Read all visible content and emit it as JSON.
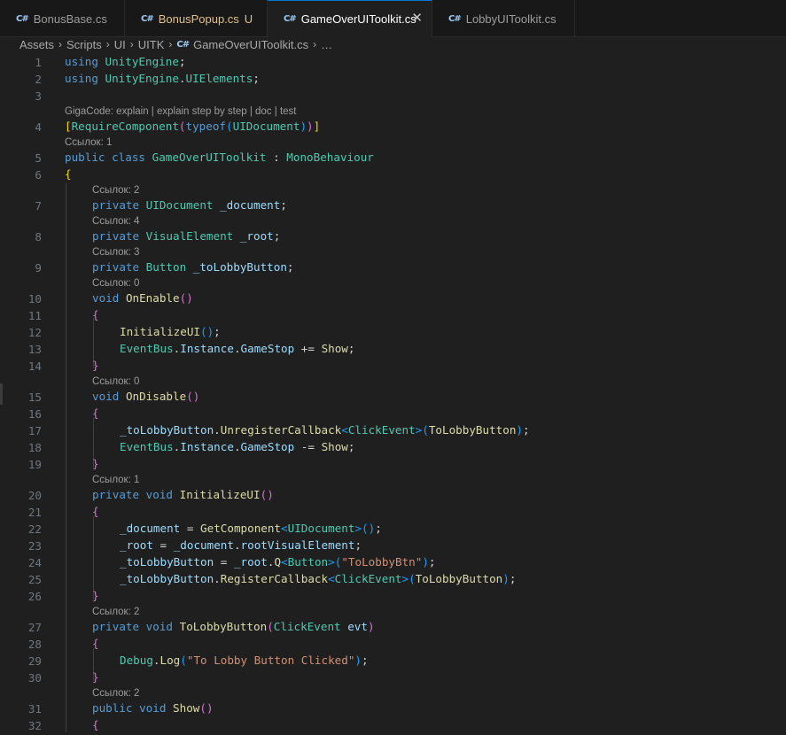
{
  "tabs": [
    {
      "label": "BonusBase.cs",
      "active": false,
      "badge": "",
      "icon": "csharp-icon"
    },
    {
      "label": "BonusPopup.cs",
      "active": false,
      "badge": "U",
      "icon": "csharp-icon"
    },
    {
      "label": "GameOverUIToolkit.cs",
      "active": true,
      "badge": "",
      "icon": "csharp-icon",
      "close": "✕"
    },
    {
      "label": "LobbyUIToolkit.cs",
      "active": false,
      "badge": "",
      "icon": "csharp-icon"
    }
  ],
  "breadcrumb": [
    "Assets",
    "Scripts",
    "UI",
    "UITK",
    "GameOverUIToolkit.cs",
    "…"
  ],
  "code_lens": {
    "gigacode": "GigaCode: explain | explain step by step | doc | test",
    "ref1": "Ссылок: 1",
    "ref2": "Ссылок: 2",
    "ref3": "Ссылок: 3",
    "ref4": "Ссылок: 4",
    "ref0": "Ссылок: 0"
  },
  "line_numbers": [
    "1",
    "2",
    "3",
    "4",
    "5",
    "6",
    "7",
    "8",
    "9",
    "10",
    "11",
    "12",
    "13",
    "14",
    "15",
    "16",
    "17",
    "18",
    "19",
    "20",
    "21",
    "22",
    "23",
    "24",
    "25",
    "26",
    "27",
    "28",
    "29",
    "30",
    "31",
    "32"
  ],
  "code": {
    "l1_a": "using",
    "l1_b": "UnityEngine",
    "l1_c": ";",
    "l2_a": "using",
    "l2_b": "UnityEngine",
    "l2_c": ".",
    "l2_d": "UIElements",
    "l2_e": ";",
    "l4_a": "[",
    "l4_b": "RequireComponent",
    "l4_c": "(",
    "l4_d": "typeof",
    "l4_e": "(",
    "l4_f": "UIDocument",
    "l4_g": ")",
    "l4_h": ")",
    "l4_i": "]",
    "l5_a": "public",
    "l5_b": "class",
    "l5_c": "GameOverUIToolkit",
    "l5_d": ":",
    "l5_e": "MonoBehaviour",
    "l6_a": "{",
    "l7_a": "private",
    "l7_b": "UIDocument",
    "l7_c": "_document",
    "l7_d": ";",
    "l8_a": "private",
    "l8_b": "VisualElement",
    "l8_c": "_root",
    "l8_d": ";",
    "l9_a": "private",
    "l9_b": "Button",
    "l9_c": "_toLobbyButton",
    "l9_d": ";",
    "l10_a": "void",
    "l10_b": "OnEnable",
    "l10_c": "()",
    "l11_a": "{",
    "l12_a": "InitializeUI",
    "l12_b": "()",
    "l12_c": ";",
    "l13_a": "EventBus",
    "l13_b": ".",
    "l13_c": "Instance",
    "l13_d": ".",
    "l13_e": "GameStop",
    "l13_f": "+=",
    "l13_g": "Show",
    "l13_h": ";",
    "l14_a": "}",
    "l15_a": "void",
    "l15_b": "OnDisable",
    "l15_c": "()",
    "l16_a": "{",
    "l17_a": "_toLobbyButton",
    "l17_b": ".",
    "l17_c": "UnregisterCallback",
    "l17_d": "<",
    "l17_e": "ClickEvent",
    "l17_f": ">",
    "l17_g": "(",
    "l17_h": "ToLobbyButton",
    "l17_i": ")",
    "l17_j": ";",
    "l18_a": "EventBus",
    "l18_b": ".",
    "l18_c": "Instance",
    "l18_d": ".",
    "l18_e": "GameStop",
    "l18_f": "-=",
    "l18_g": "Show",
    "l18_h": ";",
    "l19_a": "}",
    "l20_a": "private",
    "l20_b": "void",
    "l20_c": "InitializeUI",
    "l20_d": "()",
    "l21_a": "{",
    "l22_a": "_document",
    "l22_b": "=",
    "l22_c": "GetComponent",
    "l22_d": "<",
    "l22_e": "UIDocument",
    "l22_f": ">",
    "l22_g": "()",
    "l22_h": ";",
    "l23_a": "_root",
    "l23_b": "=",
    "l23_c": "_document",
    "l23_d": ".",
    "l23_e": "rootVisualElement",
    "l23_f": ";",
    "l24_a": "_toLobbyButton",
    "l24_b": "=",
    "l24_c": "_root",
    "l24_d": ".",
    "l24_e": "Q",
    "l24_f": "<",
    "l24_g": "Button",
    "l24_h": ">",
    "l24_i": "(",
    "l24_j": "\"ToLobbyBtn\"",
    "l24_k": ")",
    "l24_l": ";",
    "l25_a": "_toLobbyButton",
    "l25_b": ".",
    "l25_c": "RegisterCallback",
    "l25_d": "<",
    "l25_e": "ClickEvent",
    "l25_f": ">",
    "l25_g": "(",
    "l25_h": "ToLobbyButton",
    "l25_i": ")",
    "l25_j": ";",
    "l26_a": "}",
    "l27_a": "private",
    "l27_b": "void",
    "l27_c": "ToLobbyButton",
    "l27_d": "(",
    "l27_e": "ClickEvent",
    "l27_f": "evt",
    "l27_g": ")",
    "l28_a": "{",
    "l29_a": "Debug",
    "l29_b": ".",
    "l29_c": "Log",
    "l29_d": "(",
    "l29_e": "\"To Lobby Button Clicked\"",
    "l29_f": ")",
    "l29_g": ";",
    "l30_a": "}",
    "l31_a": "public",
    "l31_b": "void",
    "l31_c": "Show",
    "l31_d": "()",
    "l32_a": "{"
  },
  "colors": {
    "background": "#1f1f1f",
    "keyword": "#569cd6",
    "control_keyword": "#c586c0",
    "type": "#4ec9b0",
    "method": "#dcdcaa",
    "variable": "#9cdcfe",
    "string": "#ce9178",
    "active_tab_accent": "#0078d4",
    "modified_badge": "#e2c08d"
  }
}
